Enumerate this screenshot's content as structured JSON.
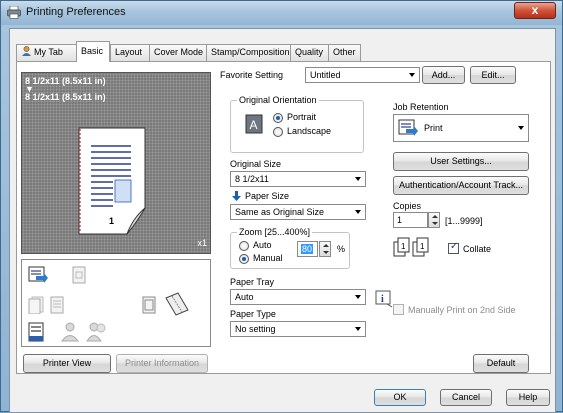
{
  "window": {
    "title": "Printing Preferences",
    "close_label": "x"
  },
  "tabs": [
    {
      "label": "My Tab"
    },
    {
      "label": "Basic"
    },
    {
      "label": "Layout"
    },
    {
      "label": "Cover Mode"
    },
    {
      "label": "Stamp/Composition"
    },
    {
      "label": "Quality"
    },
    {
      "label": "Other"
    }
  ],
  "preview": {
    "line1": "8 1/2x11 (8.5x11 in)",
    "arrow": "▼",
    "line2": "8 1/2x11 (8.5x11 in)",
    "page_number": "1",
    "copies_indicator": "x1"
  },
  "left_buttons": {
    "printer_view": "Printer View",
    "printer_information": "Printer Information"
  },
  "favorite": {
    "label": "Favorite Setting",
    "value": "Untitled",
    "add_label": "Add...",
    "edit_label": "Edit..."
  },
  "original_orientation": {
    "title": "Original Orientation",
    "portrait": "Portrait",
    "landscape": "Landscape",
    "selected": "Portrait"
  },
  "original_size": {
    "label": "Original Size",
    "value": "8 1/2x11"
  },
  "paper_size": {
    "label": "Paper Size",
    "value": "Same as Original Size"
  },
  "zoom": {
    "title": "Zoom [25...400%]",
    "auto": "Auto",
    "manual": "Manual",
    "value": "80",
    "unit": "%",
    "selected": "Manual"
  },
  "paper_tray": {
    "label": "Paper Tray",
    "value": "Auto"
  },
  "paper_type": {
    "label": "Paper Type",
    "value": "No setting"
  },
  "job_retention": {
    "label": "Job Retention",
    "value": "Print"
  },
  "right_buttons": {
    "user_settings": "User Settings...",
    "authentication": "Authentication/Account Track..."
  },
  "copies": {
    "label": "Copies",
    "value": "1",
    "range": "[1...9999]",
    "collate_label": "Collate",
    "collate_checked": true
  },
  "manual_print": {
    "label": "Manually Print on 2nd Side",
    "checked": false
  },
  "default_label": "Default",
  "footer": {
    "ok": "OK",
    "cancel": "Cancel",
    "help": "Help"
  },
  "colors": {
    "accent": "#1a5fb4",
    "highlight": "#3399ff"
  }
}
